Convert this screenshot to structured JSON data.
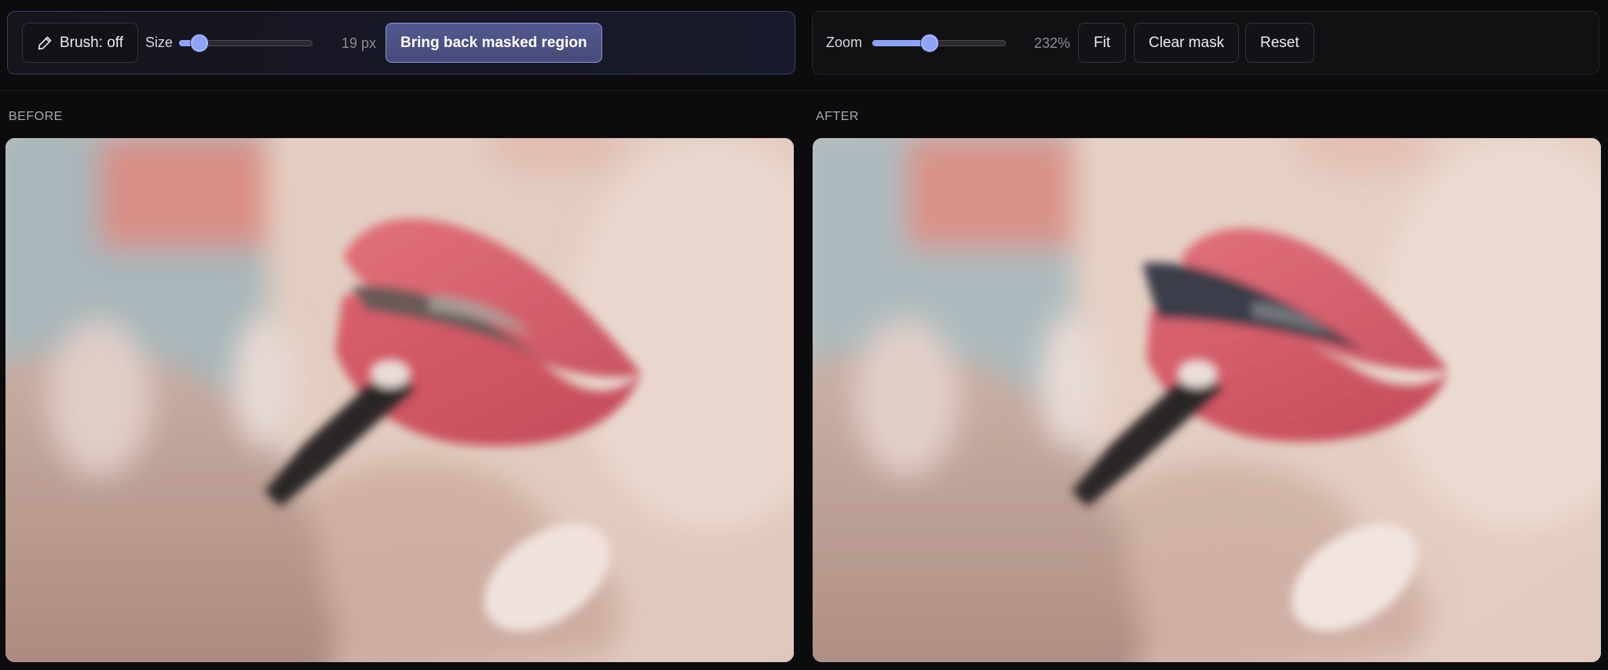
{
  "toolbar_left": {
    "brush_label": "Brush: off",
    "brush_icon": "pencil-icon",
    "size_label": "Size",
    "size_value": "19 px",
    "size_fraction": 0.1,
    "restore_button_label": "Bring back masked region"
  },
  "toolbar_right": {
    "zoom_label": "Zoom",
    "zoom_value": "232%",
    "zoom_fraction": 0.42,
    "fit_label": "Fit",
    "clear_mask_label": "Clear mask",
    "reset_label": "Reset"
  },
  "panels": {
    "before_label": "BEFORE",
    "after_label": "AFTER"
  },
  "colors": {
    "accent": "#8ea2f6",
    "primary_button": "#4e5387",
    "primary_border": "#8e93d6",
    "background": "#0c0c0e"
  }
}
